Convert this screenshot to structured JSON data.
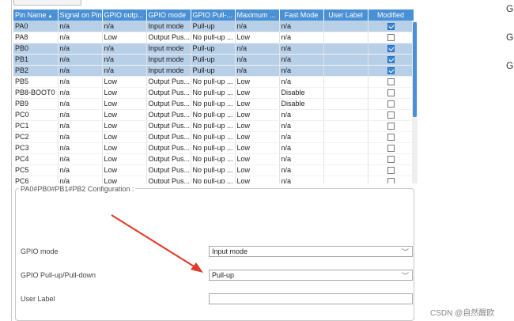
{
  "table": {
    "columns": [
      "Pin Name",
      "Signal on Pin",
      "GPIO outp...",
      "GPIO mode",
      "GPIO Pull-...",
      "Maximum ...",
      "Fast Mode",
      "User Label",
      "Modified"
    ],
    "rows": [
      {
        "pin": "PA0",
        "signal": "n/a",
        "out": "n/a",
        "mode": "Input mode",
        "pull": "Pull-up",
        "max": "n/a",
        "fast": "n/a",
        "label": "",
        "modified": true,
        "selected": true
      },
      {
        "pin": "PA8",
        "signal": "n/a",
        "out": "Low",
        "mode": "Output Pus...",
        "pull": "No pull-up ...",
        "max": "Low",
        "fast": "n/a",
        "label": "",
        "modified": false,
        "selected": false
      },
      {
        "pin": "PB0",
        "signal": "n/a",
        "out": "n/a",
        "mode": "Input mode",
        "pull": "Pull-up",
        "max": "n/a",
        "fast": "n/a",
        "label": "",
        "modified": true,
        "selected": true
      },
      {
        "pin": "PB1",
        "signal": "n/a",
        "out": "n/a",
        "mode": "Input mode",
        "pull": "Pull-up",
        "max": "n/a",
        "fast": "n/a",
        "label": "",
        "modified": true,
        "selected": true
      },
      {
        "pin": "PB2",
        "signal": "n/a",
        "out": "n/a",
        "mode": "Input mode",
        "pull": "Pull-up",
        "max": "n/a",
        "fast": "n/a",
        "label": "",
        "modified": true,
        "selected": true
      },
      {
        "pin": "PB5",
        "signal": "n/a",
        "out": "Low",
        "mode": "Output Pus...",
        "pull": "No pull-up ...",
        "max": "Low",
        "fast": "n/a",
        "label": "",
        "modified": false,
        "selected": false
      },
      {
        "pin": "PB8-BOOT0",
        "signal": "n/a",
        "out": "Low",
        "mode": "Output Pus...",
        "pull": "No pull-up ...",
        "max": "Low",
        "fast": "Disable",
        "label": "",
        "modified": false,
        "selected": false
      },
      {
        "pin": "PB9",
        "signal": "n/a",
        "out": "Low",
        "mode": "Output Pus...",
        "pull": "No pull-up ...",
        "max": "Low",
        "fast": "Disable",
        "label": "",
        "modified": false,
        "selected": false
      },
      {
        "pin": "PC0",
        "signal": "n/a",
        "out": "Low",
        "mode": "Output Pus...",
        "pull": "No pull-up ...",
        "max": "Low",
        "fast": "n/a",
        "label": "",
        "modified": false,
        "selected": false
      },
      {
        "pin": "PC1",
        "signal": "n/a",
        "out": "Low",
        "mode": "Output Pus...",
        "pull": "No pull-up ...",
        "max": "Low",
        "fast": "n/a",
        "label": "",
        "modified": false,
        "selected": false
      },
      {
        "pin": "PC2",
        "signal": "n/a",
        "out": "Low",
        "mode": "Output Pus...",
        "pull": "No pull-up ...",
        "max": "Low",
        "fast": "n/a",
        "label": "",
        "modified": false,
        "selected": false
      },
      {
        "pin": "PC3",
        "signal": "n/a",
        "out": "Low",
        "mode": "Output Pus...",
        "pull": "No pull-up ...",
        "max": "Low",
        "fast": "n/a",
        "label": "",
        "modified": false,
        "selected": false
      },
      {
        "pin": "PC4",
        "signal": "n/a",
        "out": "Low",
        "mode": "Output Pus...",
        "pull": "No pull-up ...",
        "max": "Low",
        "fast": "n/a",
        "label": "",
        "modified": false,
        "selected": false
      },
      {
        "pin": "PC5",
        "signal": "n/a",
        "out": "Low",
        "mode": "Output Pus...",
        "pull": "No pull-up ...",
        "max": "Low",
        "fast": "n/a",
        "label": "",
        "modified": false,
        "selected": false
      },
      {
        "pin": "PC6",
        "signal": "n/a",
        "out": "Low",
        "mode": "Output Pus...",
        "pull": "No pull-up ...",
        "max": "Low",
        "fast": "n/a",
        "label": "",
        "modified": false,
        "selected": false
      }
    ]
  },
  "config": {
    "title": "PA0#PB0#PB1#PB2 Configuration :",
    "gpio_mode_label": "GPIO mode",
    "gpio_mode_value": "Input mode",
    "pull_label": "GPIO Pull-up/Pull-down",
    "pull_value": "Pull-up",
    "user_label_label": "User Label",
    "user_label_value": ""
  },
  "right_side": {
    "letters": [
      "G",
      "G",
      "G"
    ]
  },
  "watermark": "CSDN @自然醒欧",
  "colors": {
    "header_bg": "#4a90d4",
    "selected_row_bg": "#b8cfe8",
    "checkbox_on": "#3b86d6",
    "annotation_arrow": "#e23a2c"
  },
  "icons": {
    "dropdown": "chevron-down-icon",
    "sort": "sort-ascending-icon",
    "checkbox": "checkbox-icon"
  }
}
